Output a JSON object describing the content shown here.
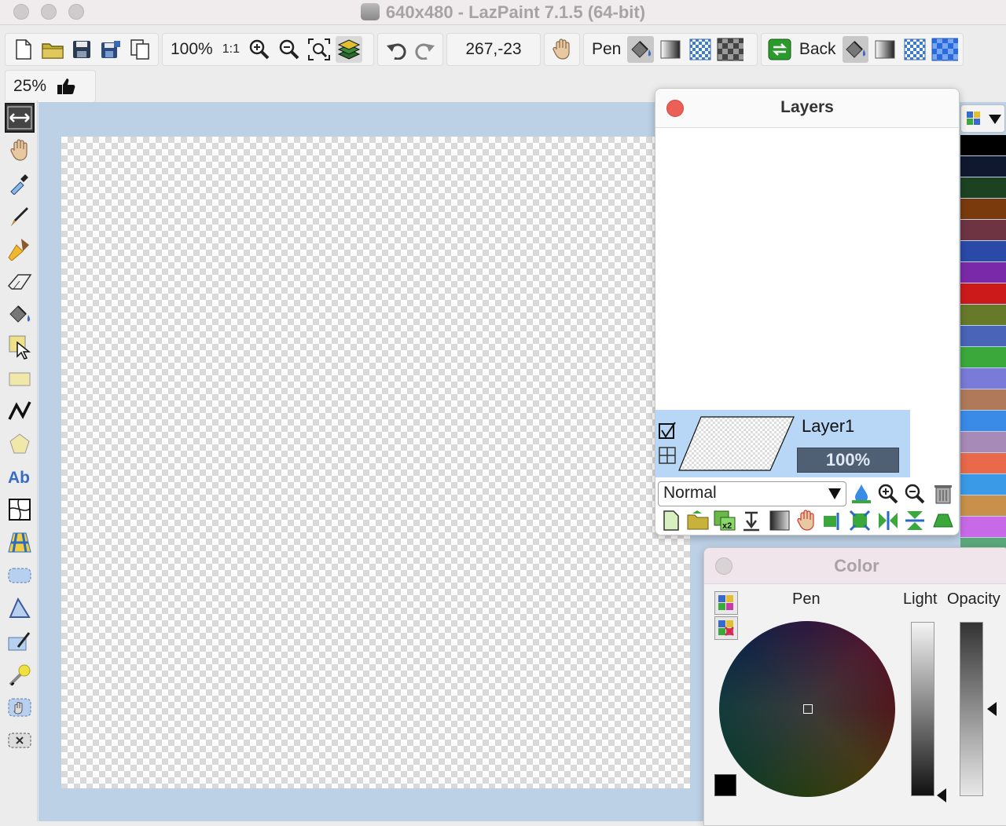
{
  "window": {
    "title": "640x480 - LazPaint 7.1.5 (64-bit)"
  },
  "toolbar": {
    "zoom_value": "100%",
    "actual_size_label": "1:1",
    "coordinates": "267,-23",
    "pen_label": "Pen",
    "back_label": "Back",
    "opacity_value": "25%"
  },
  "layers_panel": {
    "title": "Layers",
    "layer_name": "Layer1",
    "layer_opacity": "100%",
    "blend_mode": "Normal"
  },
  "color_panel": {
    "title": "Color",
    "pen_label": "Pen",
    "light_label": "Light",
    "opacity_label": "Opacity"
  },
  "palette": {
    "swatches": [
      "#000000",
      "#101830",
      "#1c4222",
      "#7a3a0c",
      "#6e3442",
      "#2a4aa8",
      "#7a2aa8",
      "#cc1a1a",
      "#667a2a",
      "#4a64b8",
      "#3aa83a",
      "#7a7ad8",
      "#b07a5a",
      "#3a8ae8",
      "#a88ab8",
      "#e86a4a",
      "#3a9ae8",
      "#c8904a",
      "#c86ae8",
      "#5aa87a"
    ]
  },
  "colors": {
    "canvas_background": "#bcd0e6",
    "layer_selected": "#b8d6f6",
    "close_red": "#ec5f57"
  }
}
